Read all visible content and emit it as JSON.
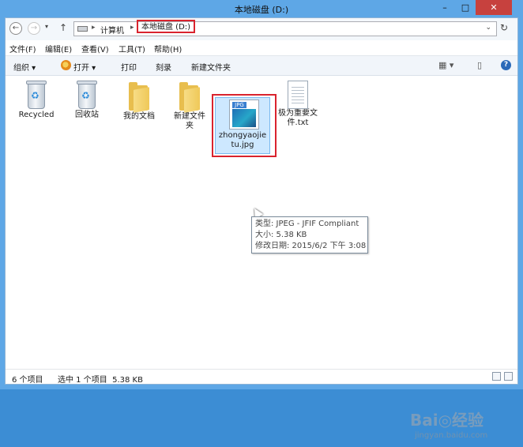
{
  "window": {
    "title": "本地磁盘 (D:)",
    "controls": {
      "minimize": "–",
      "maximize": "□",
      "close": "✕"
    }
  },
  "address": {
    "crumbs": [
      "计算机",
      "本地磁盘 (D:)"
    ],
    "separator": "▸",
    "dropdown": "⌄",
    "refresh": "↻"
  },
  "nav": {
    "back": "←",
    "forward": "→",
    "recent": "▾",
    "up": "↑"
  },
  "menu": [
    {
      "label": "文件(F)"
    },
    {
      "label": "编辑(E)"
    },
    {
      "label": "查看(V)"
    },
    {
      "label": "工具(T)"
    },
    {
      "label": "帮助(H)"
    }
  ],
  "toolbar": {
    "organize": "组织 ▾",
    "open": "打开 ▾",
    "print": "打印",
    "burn": "刻录",
    "new_folder": "新建文件夹",
    "view": "▦ ▾",
    "pane": "▯",
    "help": "?"
  },
  "files": [
    {
      "label": "Recycled",
      "icon": "recycle-bin-icon"
    },
    {
      "label": "回收站",
      "icon": "recycle-bin-icon"
    },
    {
      "label": "我的文档",
      "icon": "folder-icon"
    },
    {
      "label": "新建文件夹",
      "icon": "folder-icon"
    },
    {
      "label": "zhongyaojietu.jpg",
      "icon": "jpg-file-icon",
      "badge": "JPG",
      "selected": true
    },
    {
      "label": "极为重要文件.txt",
      "icon": "text-file-icon"
    }
  ],
  "tooltip": {
    "type": "类型: JPEG - JFIF Compliant",
    "size": "大小: 5.38 KB",
    "modified": "修改日期: 2015/6/2 下午 3:08"
  },
  "status": {
    "count": "6 个项目",
    "selection": "选中 1 个项目  5.38 KB"
  },
  "watermark": {
    "logo": "Bai◎经验",
    "url": "jingyan.baidu.com"
  },
  "colors": {
    "highlight": "#d9232e",
    "selection": "#cde8ff",
    "titlebar": "#5ea7e6",
    "close": "#c7413e"
  }
}
